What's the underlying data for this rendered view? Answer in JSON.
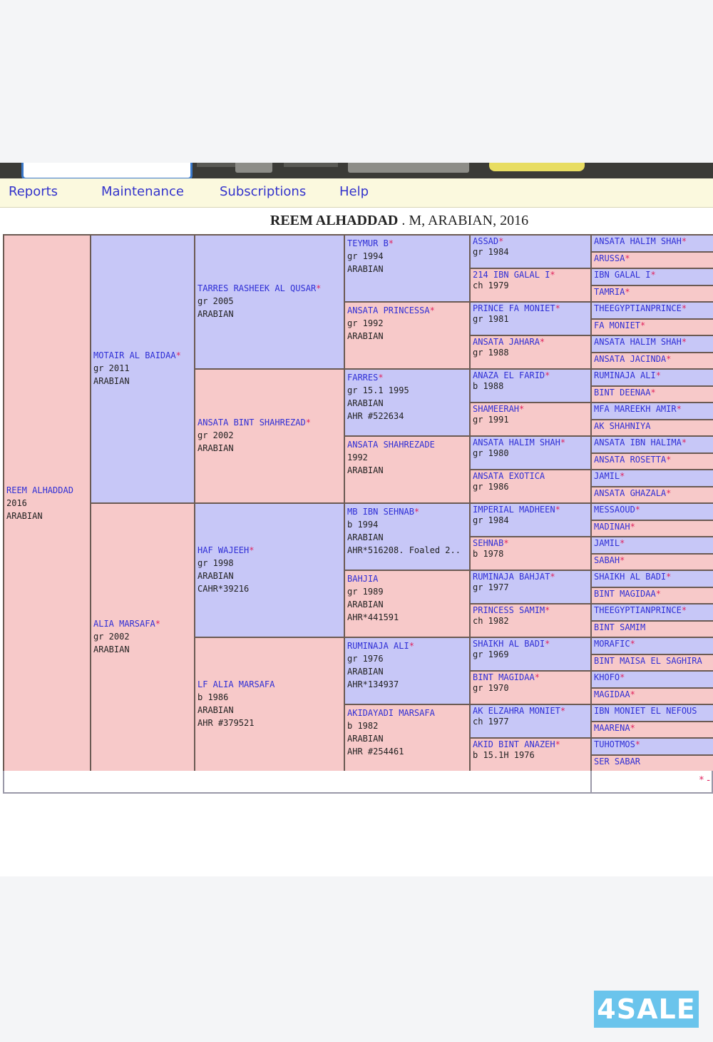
{
  "menu": [
    "Reports",
    "Maintenance",
    "Subscriptions",
    "Help"
  ],
  "title": {
    "name": "REEM ALHADDAD",
    "rest": " . M, ARABIAN, 2016"
  },
  "gen1": [
    {
      "name": "REEM ALHADDAD",
      "star": "",
      "lines": [
        "2016",
        "ARABIAN"
      ],
      "sex": "f"
    }
  ],
  "gen2": [
    {
      "name": "MOTAIR AL BAIDAA",
      "star": "*",
      "lines": [
        "gr 2011",
        "ARABIAN"
      ],
      "sex": "m"
    },
    {
      "name": "ALIA MARSAFA",
      "star": "*",
      "lines": [
        "gr 2002",
        "ARABIAN"
      ],
      "sex": "f"
    }
  ],
  "gen3": [
    {
      "name": "TARRES RASHEEK AL QUSAR",
      "star": "*",
      "lines": [
        "gr 2005",
        "ARABIAN"
      ],
      "sex": "m"
    },
    {
      "name": "ANSATA BINT SHAHREZAD",
      "star": "*",
      "lines": [
        "gr 2002",
        "ARABIAN"
      ],
      "sex": "f"
    },
    {
      "name": "HAF WAJEEH",
      "star": "*",
      "lines": [
        "gr 1998",
        "ARABIAN",
        "CAHR*39216"
      ],
      "sex": "m"
    },
    {
      "name": "LF ALIA MARSAFA",
      "star": "",
      "lines": [
        "b 1986",
        "ARABIAN",
        "AHR #379521"
      ],
      "sex": "f"
    }
  ],
  "gen4": [
    {
      "name": "TEYMUR B",
      "star": "*",
      "lines": [
        "gr 1994",
        "ARABIAN"
      ],
      "sex": "m"
    },
    {
      "name": "ANSATA PRINCESSA",
      "star": "*",
      "lines": [
        "gr 1992",
        "ARABIAN"
      ],
      "sex": "f"
    },
    {
      "name": "FARRES",
      "star": "*",
      "lines": [
        "gr 15.1 1995",
        "ARABIAN",
        "AHR #522634"
      ],
      "sex": "m"
    },
    {
      "name": "ANSATA SHAHREZADE",
      "star": "",
      "lines": [
        "1992",
        "ARABIAN"
      ],
      "sex": "f"
    },
    {
      "name": "MB IBN SEHNAB",
      "star": "*",
      "lines": [
        "b 1994",
        "ARABIAN",
        "AHR*516208. Foaled 2.."
      ],
      "sex": "m"
    },
    {
      "name": "BAHJIA",
      "star": "",
      "lines": [
        "gr 1989",
        "ARABIAN",
        "AHR*441591"
      ],
      "sex": "f"
    },
    {
      "name": "RUMINAJA ALI",
      "star": "*",
      "lines": [
        "gr 1976",
        "ARABIAN",
        "AHR*134937"
      ],
      "sex": "m"
    },
    {
      "name": "AKIDAYADI MARSAFA",
      "star": "",
      "lines": [
        "b 1982",
        "ARABIAN",
        "AHR #254461"
      ],
      "sex": "f"
    }
  ],
  "gen5": [
    {
      "name": "ASSAD",
      "star": "*",
      "lines": [
        "gr 1984"
      ],
      "sex": "m"
    },
    {
      "name": "214 IBN GALAL I",
      "star": "*",
      "lines": [
        "ch 1979"
      ],
      "sex": "f"
    },
    {
      "name": "PRINCE FA MONIET",
      "star": "*",
      "lines": [
        "gr 1981"
      ],
      "sex": "m"
    },
    {
      "name": "ANSATA JAHARA",
      "star": "*",
      "lines": [
        "gr 1988"
      ],
      "sex": "f"
    },
    {
      "name": "ANAZA EL FARID",
      "star": "*",
      "lines": [
        "b 1988"
      ],
      "sex": "m"
    },
    {
      "name": "SHAMEERAH",
      "star": "*",
      "lines": [
        "gr 1991"
      ],
      "sex": "f"
    },
    {
      "name": "ANSATA HALIM SHAH",
      "star": "*",
      "lines": [
        "gr 1980"
      ],
      "sex": "m"
    },
    {
      "name": "ANSATA EXOTICA",
      "star": "",
      "lines": [
        "gr 1986"
      ],
      "sex": "f"
    },
    {
      "name": "IMPERIAL MADHEEN",
      "star": "*",
      "lines": [
        "gr 1984"
      ],
      "sex": "m"
    },
    {
      "name": "SEHNAB",
      "star": "*",
      "lines": [
        "b 1978"
      ],
      "sex": "f"
    },
    {
      "name": "RUMINAJA BAHJAT",
      "star": "*",
      "lines": [
        "gr 1977"
      ],
      "sex": "m"
    },
    {
      "name": "PRINCESS SAMIM",
      "star": "*",
      "lines": [
        "ch 1982"
      ],
      "sex": "f"
    },
    {
      "name": "SHAIKH AL BADI",
      "star": "*",
      "lines": [
        "gr 1969"
      ],
      "sex": "m"
    },
    {
      "name": "BINT MAGIDAA",
      "star": "*",
      "lines": [
        "gr 1970"
      ],
      "sex": "f"
    },
    {
      "name": "AK ELZAHRA MONIET",
      "star": "*",
      "lines": [
        "ch 1977"
      ],
      "sex": "m"
    },
    {
      "name": "AKID BINT ANAZEH",
      "star": "*",
      "lines": [
        "b 15.1H 1976"
      ],
      "sex": "f"
    }
  ],
  "gen6": [
    {
      "name": "ANSATA HALIM SHAH",
      "star": "*",
      "sex": "m"
    },
    {
      "name": "ARUSSA",
      "star": "*",
      "sex": "f"
    },
    {
      "name": "IBN GALAL I",
      "star": "*",
      "sex": "m"
    },
    {
      "name": "TAMRIA",
      "star": "*",
      "sex": "f"
    },
    {
      "name": "THEEGYPTIANPRINCE",
      "star": "*",
      "sex": "m"
    },
    {
      "name": "FA MONIET",
      "star": "*",
      "sex": "f"
    },
    {
      "name": "ANSATA HALIM SHAH",
      "star": "*",
      "sex": "m"
    },
    {
      "name": "ANSATA JACINDA",
      "star": "*",
      "sex": "f"
    },
    {
      "name": "RUMINAJA ALI",
      "star": "*",
      "sex": "m"
    },
    {
      "name": "BINT DEENAA",
      "star": "*",
      "sex": "f"
    },
    {
      "name": "MFA MAREEKH AMIR",
      "star": "*",
      "sex": "m"
    },
    {
      "name": "AK SHAHNIYA",
      "star": "",
      "sex": "f"
    },
    {
      "name": "ANSATA IBN HALIMA",
      "star": "*",
      "sex": "m"
    },
    {
      "name": "ANSATA ROSETTA",
      "star": "*",
      "sex": "f"
    },
    {
      "name": "JAMIL",
      "star": "*",
      "sex": "m"
    },
    {
      "name": "ANSATA GHAZALA",
      "star": "*",
      "sex": "f"
    },
    {
      "name": "MESSAOUD",
      "star": "*",
      "sex": "m"
    },
    {
      "name": "MADINAH",
      "star": "*",
      "sex": "f"
    },
    {
      "name": "JAMIL",
      "star": "*",
      "sex": "m"
    },
    {
      "name": "SABAH",
      "star": "*",
      "sex": "f"
    },
    {
      "name": "SHAIKH AL BADI",
      "star": "*",
      "sex": "m"
    },
    {
      "name": "BINT MAGIDAA",
      "star": "*",
      "sex": "f"
    },
    {
      "name": "THEEGYPTIANPRINCE",
      "star": "*",
      "sex": "m"
    },
    {
      "name": "BINT SAMIM",
      "star": "",
      "sex": "f"
    },
    {
      "name": "MORAFIC",
      "star": "*",
      "sex": "m"
    },
    {
      "name": "BINT MAISA EL SAGHIRA",
      "star": "",
      "sex": "f"
    },
    {
      "name": "KHOFO",
      "star": "*",
      "sex": "m"
    },
    {
      "name": "MAGIDAA",
      "star": "*",
      "sex": "f"
    },
    {
      "name": "IBN MONIET EL NEFOUS",
      "star": "",
      "sex": "m"
    },
    {
      "name": "MAARENA",
      "star": "*",
      "sex": "f"
    },
    {
      "name": "TUHOTMOS",
      "star": "*",
      "sex": "m"
    },
    {
      "name": "SER SABAR",
      "star": "",
      "sex": "f"
    }
  ],
  "legend": "* -",
  "badge": "4SALE",
  "colors": {
    "male": "#c7c7f7",
    "female": "#f7c9c9",
    "link": "#2f2fd6",
    "star": "#e0245e",
    "menubar": "#fbf9de",
    "badge": "#6ac4ec"
  }
}
